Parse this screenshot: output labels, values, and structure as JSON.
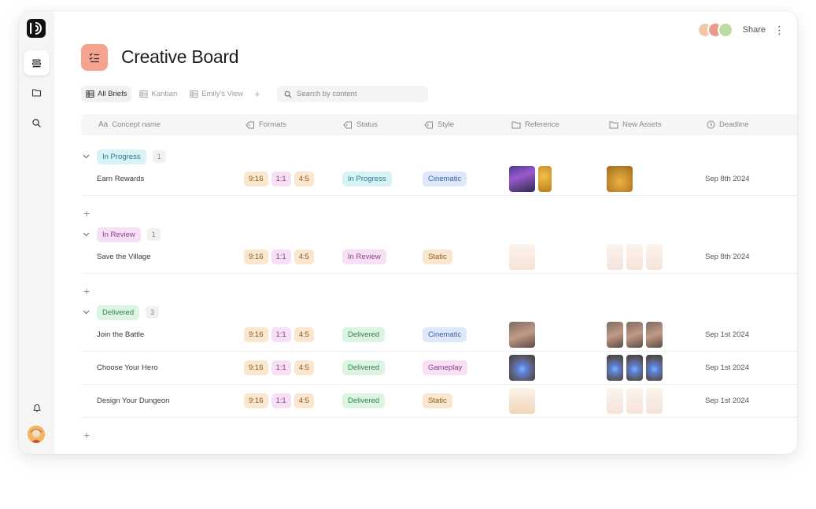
{
  "app": {
    "title": "Creative Board",
    "share_label": "Share",
    "more_label": "⋮"
  },
  "views": {
    "tabs": [
      {
        "label": "All Briefs",
        "active": true
      },
      {
        "label": "Kanban",
        "active": false
      },
      {
        "label": "Emily's View",
        "active": false
      }
    ],
    "add_label": "+"
  },
  "search": {
    "placeholder": "Search by content",
    "value": ""
  },
  "columns": {
    "concept": "Concept name",
    "formats": "Formats",
    "status": "Status",
    "style": "Style",
    "reference": "Reference",
    "new_assets": "New Assets",
    "deadline": "Deadline"
  },
  "colors": {
    "title_icon": "#f5a28e",
    "in_progress_bg": "#d8f3f7",
    "in_progress_fg": "#2b7b8a",
    "in_review_bg": "#f7e0f5",
    "in_review_fg": "#8a3f86",
    "delivered_bg": "#dcf5e3",
    "delivered_fg": "#3a7d4f",
    "cinematic_bg": "#dde8fb",
    "cinematic_fg": "#3d5ea8",
    "static_bg": "#fbe7cf",
    "static_fg": "#8a5a20",
    "gameplay_bg": "#f7e0f5",
    "gameplay_fg": "#8a3f86"
  },
  "groups": [
    {
      "label": "In Progress",
      "count": "1",
      "key": "in_progress",
      "rows": [
        {
          "name": "Earn Rewards",
          "formats": [
            "9:16",
            "1:1",
            "4:5"
          ],
          "status": "In Progress",
          "style": "Cinematic",
          "reference_thumbs": [
            "purple-game-scene",
            "gold-coins"
          ],
          "asset_thumbs": [
            "earn-character-title"
          ],
          "deadline": "Sep 8th 2024"
        }
      ]
    },
    {
      "label": "In Review",
      "count": "1",
      "key": "in_review",
      "rows": [
        {
          "name": "Save the Village",
          "formats": [
            "9:16",
            "1:1",
            "4:5"
          ],
          "status": "In Review",
          "style": "Static",
          "reference_thumbs": [
            "dragon-poster"
          ],
          "asset_thumbs": [
            "dragon-poster",
            "dragon-poster",
            "dragon-poster"
          ],
          "deadline": "Sep 8th 2024"
        }
      ]
    },
    {
      "label": "Delivered",
      "count": "3",
      "key": "delivered",
      "rows": [
        {
          "name": "Join the Battle",
          "formats": [
            "9:16",
            "1:1",
            "4:5"
          ],
          "status": "Delivered",
          "style": "Cinematic",
          "reference_thumbs": [
            "battle-scene"
          ],
          "asset_thumbs": [
            "battle-scene",
            "battle-scene",
            "battle-scene"
          ],
          "deadline": "Sep 1st 2024"
        },
        {
          "name": "Choose Your Hero",
          "formats": [
            "9:16",
            "1:1",
            "4:5"
          ],
          "status": "Delivered",
          "style": "Gameplay",
          "reference_thumbs": [
            "hero-select"
          ],
          "asset_thumbs": [
            "hero-select",
            "hero-select",
            "hero-select"
          ],
          "deadline": "Sep 1st 2024"
        },
        {
          "name": "Design Your Dungeon",
          "formats": [
            "9:16",
            "1:1",
            "4:5"
          ],
          "status": "Delivered",
          "style": "Static",
          "reference_thumbs": [
            "dungeon-scene"
          ],
          "asset_thumbs": [
            "dragon-poster",
            "dragon-poster",
            "dragon-poster"
          ],
          "deadline": "Sep 1st 2024"
        }
      ]
    }
  ],
  "add_row_label": "+"
}
